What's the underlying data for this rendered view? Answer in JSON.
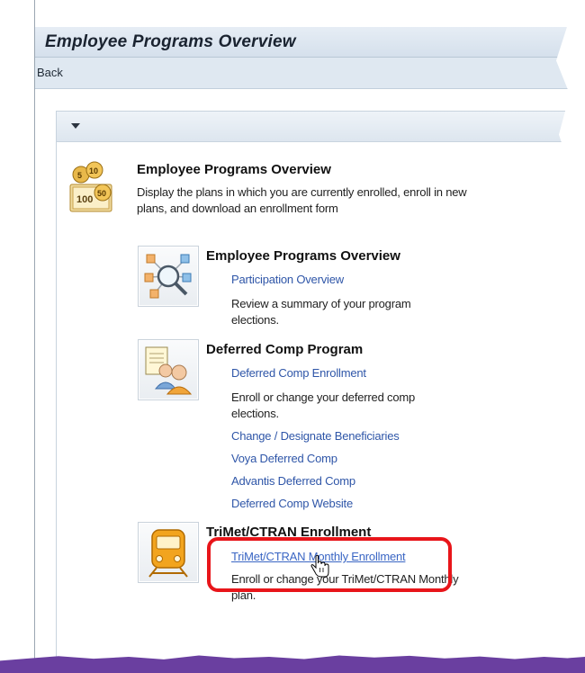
{
  "window": {
    "title": "Employee Programs Overview"
  },
  "nav": {
    "back_label": "Back"
  },
  "main_block": {
    "heading": "Employee Programs Overview",
    "description": "Display the plans in which you are currently enrolled, enroll in new plans, and download an enrollment form",
    "icon": "coins-money-icon"
  },
  "sections": [
    {
      "heading": "Employee Programs Overview",
      "icon": "network-magnifier-icon",
      "primary_link": "Participation Overview",
      "description": "Review a summary of your program elections."
    },
    {
      "heading": "Deferred Comp Program",
      "icon": "documents-person-icon",
      "primary_link": "Deferred Comp Enrollment",
      "description": "Enroll or change your deferred comp elections.",
      "extra_links": [
        "Change / Designate Beneficiaries",
        "Voya Deferred Comp",
        "Advantis Deferred Comp",
        "Deferred Comp Website"
      ]
    },
    {
      "heading": "TriMet/CTRAN Enrollment",
      "icon": "train-icon",
      "primary_link": "TriMet/CTRAN Monthly Enrollment",
      "description": "Enroll or change your TriMet/CTRAN Monthly plan."
    }
  ],
  "colors": {
    "link": "#2f56a8",
    "highlight": "#e8151a",
    "band": "#6a3fa0"
  }
}
